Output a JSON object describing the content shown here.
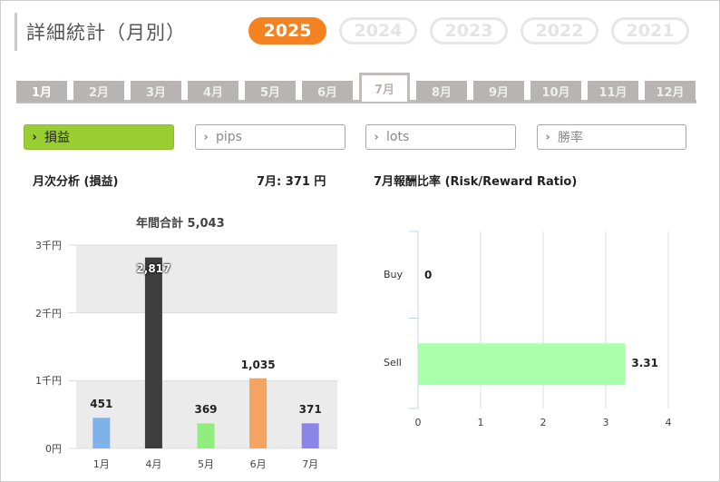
{
  "header": {
    "title": "詳細統計（月別）"
  },
  "years": [
    {
      "label": "2025",
      "active": true
    },
    {
      "label": "2024",
      "active": false
    },
    {
      "label": "2023",
      "active": false
    },
    {
      "label": "2022",
      "active": false
    },
    {
      "label": "2021",
      "active": false
    }
  ],
  "months": [
    "1月",
    "2月",
    "3月",
    "4月",
    "5月",
    "6月",
    "7月",
    "8月",
    "9月",
    "10月",
    "11月",
    "12月"
  ],
  "active_month": "7月",
  "metrics": [
    {
      "label": "損益",
      "active": true
    },
    {
      "label": "pips",
      "active": false
    },
    {
      "label": "lots",
      "active": false
    },
    {
      "label": "勝率",
      "active": false
    }
  ],
  "left_panel": {
    "heading": "月次分析 (損益)",
    "month_summary": "7月:  371 円"
  },
  "right_panel": {
    "heading": "7月報酬比率 (Risk/Reward Ratio)"
  },
  "colors": {
    "accent": "#f58220",
    "metric_active": "#9acd32"
  },
  "chart_data": [
    {
      "type": "bar",
      "title": "年間合計 5,043",
      "categories": [
        "1月",
        "4月",
        "5月",
        "6月",
        "7月"
      ],
      "values": [
        451,
        2817,
        369,
        1035,
        371
      ],
      "value_labels": [
        "451",
        "2,817",
        "369",
        "1,035",
        "371"
      ],
      "bar_colors": [
        "#7fb2e8",
        "#3d3d3d",
        "#90ee7e",
        "#f4a460",
        "#8b85e8"
      ],
      "yticks": [
        "0円",
        "1千円",
        "2千円",
        "3千円"
      ],
      "ylim": [
        0,
        3000
      ],
      "grid": "alternating bands"
    },
    {
      "type": "bar",
      "orientation": "horizontal",
      "categories": [
        "Buy",
        "Sell"
      ],
      "values": [
        0,
        3.31
      ],
      "value_labels": [
        "0",
        "3.31"
      ],
      "bar_color": "#aaffaa",
      "xticks": [
        "0",
        "1",
        "2",
        "3",
        "4"
      ],
      "xlim": [
        0,
        4
      ],
      "grid": true
    }
  ]
}
